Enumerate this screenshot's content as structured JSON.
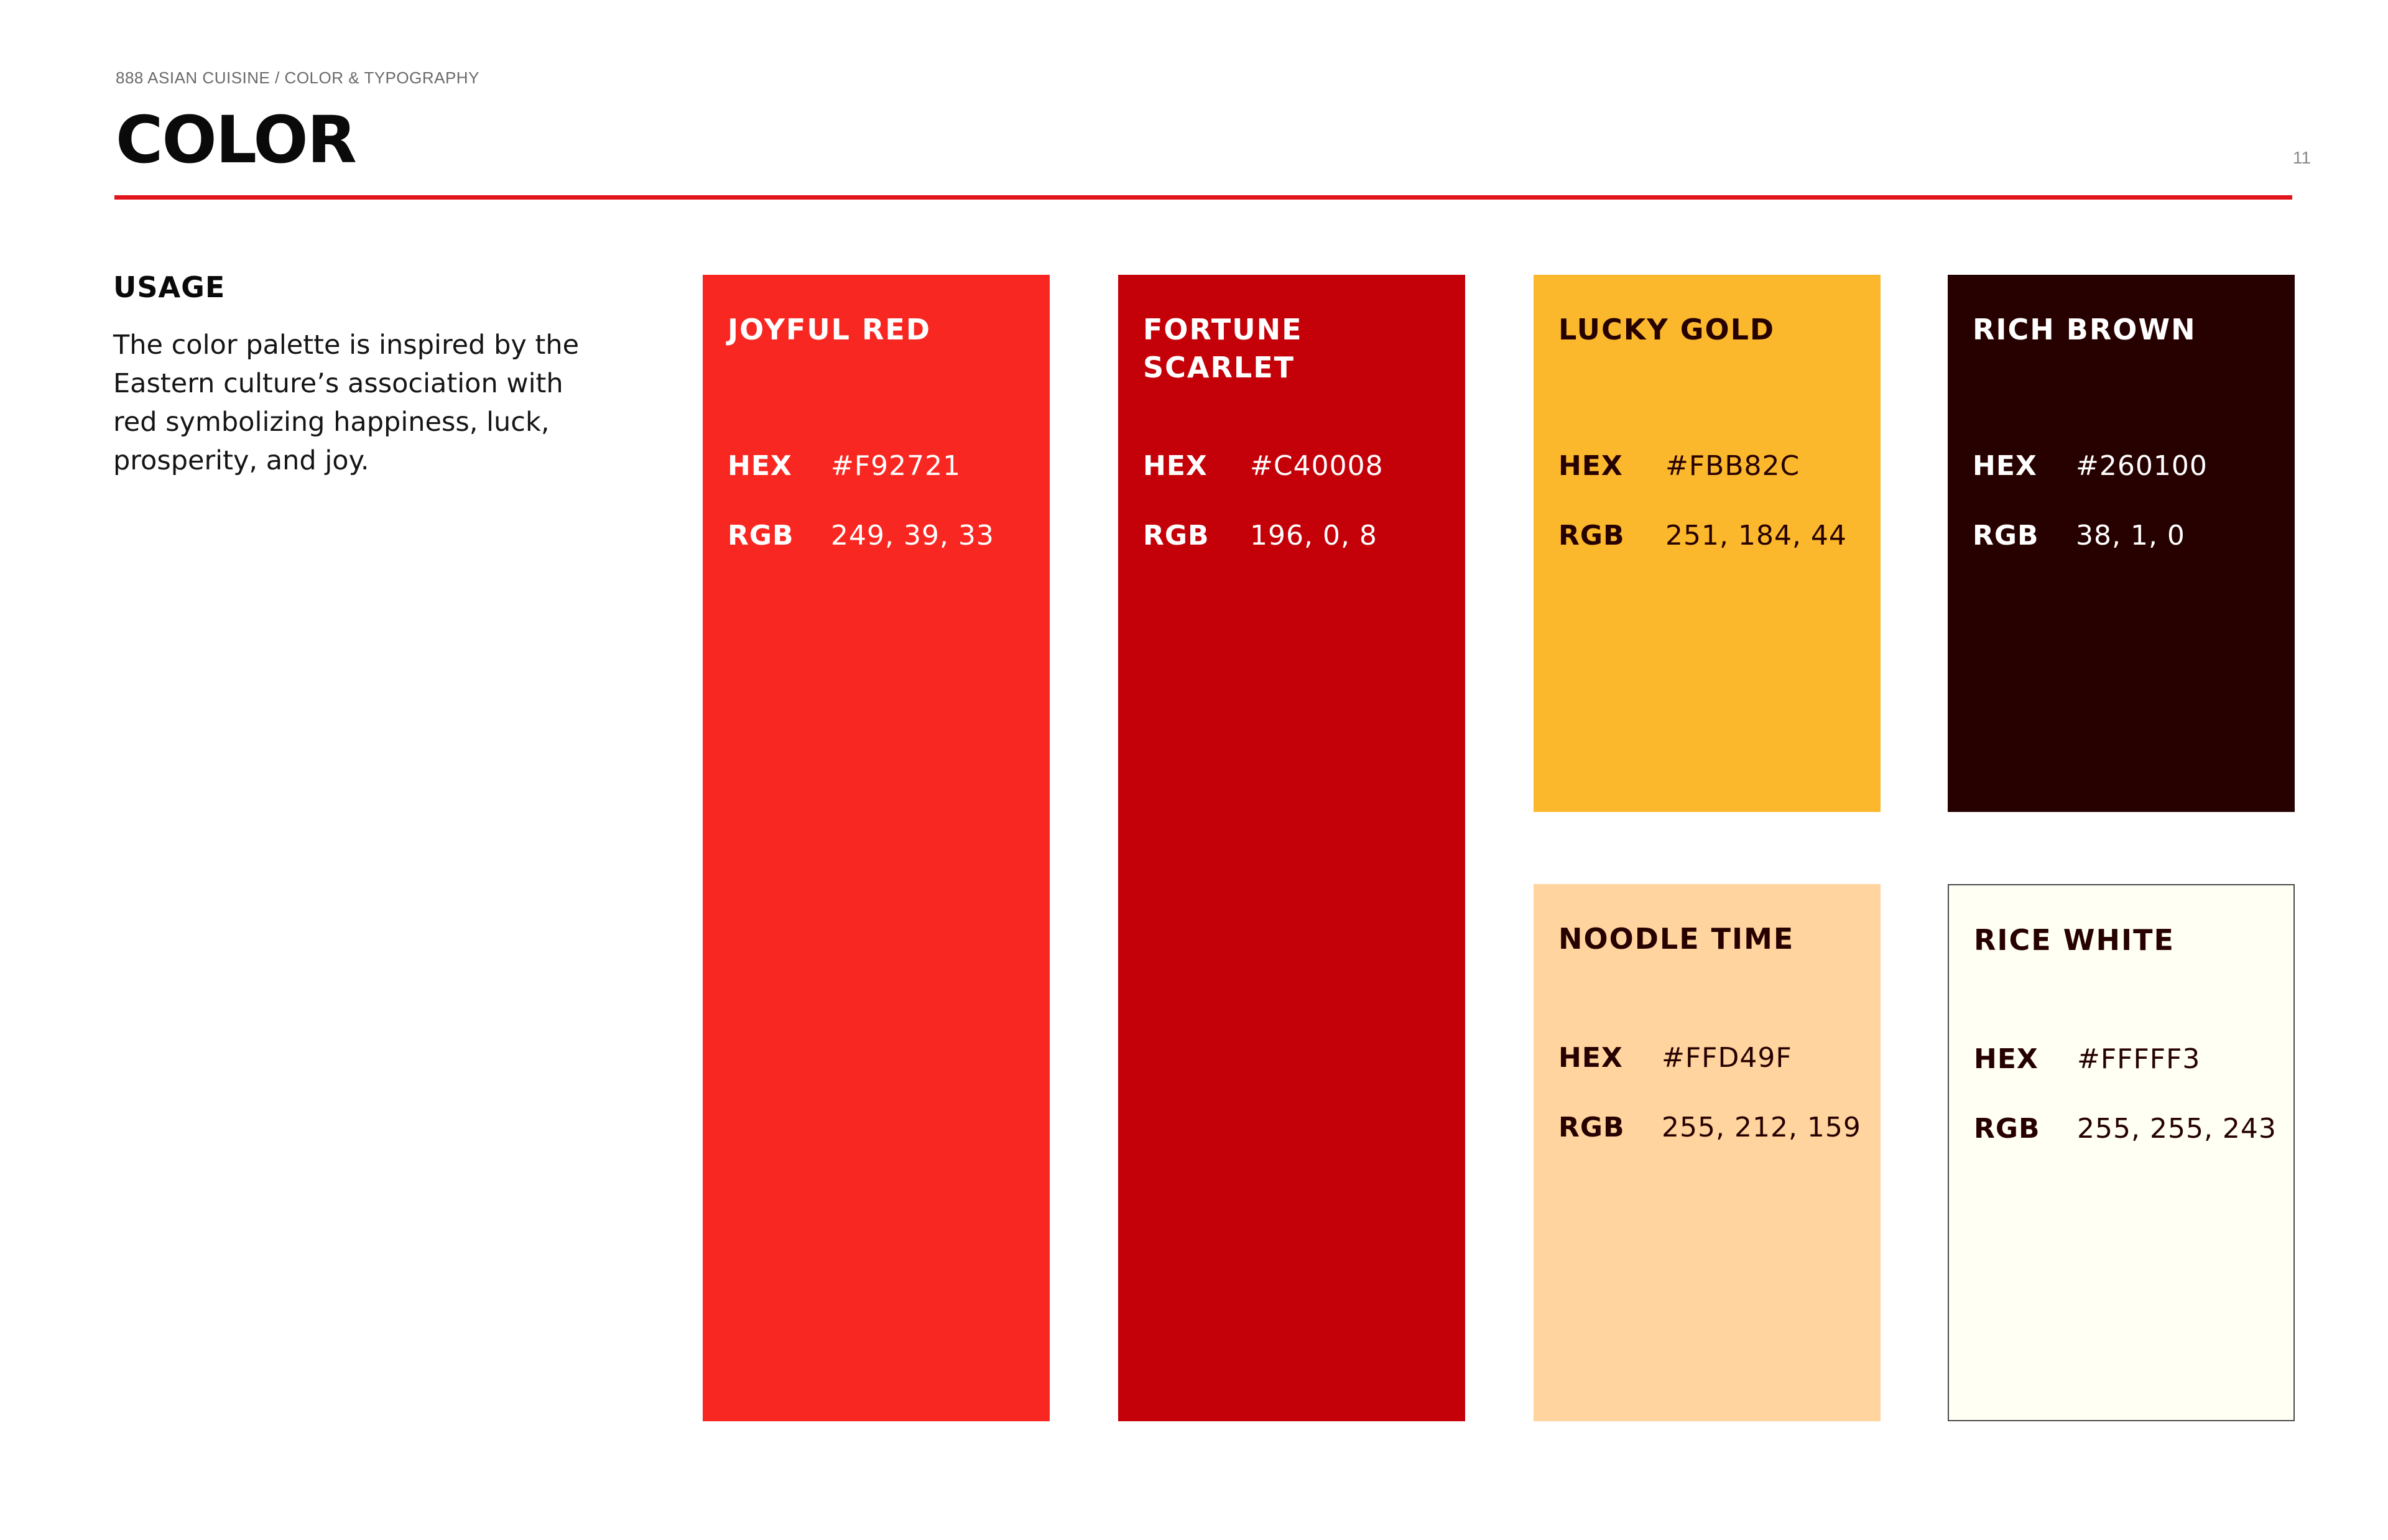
{
  "header": {
    "breadcrumb": "888 ASIAN CUISINE / COLOR & TYPOGRAPHY",
    "title": "COLOR",
    "page_number": "11",
    "rule_color": "#E2141B"
  },
  "usage": {
    "heading": "USAGE",
    "body": "The color palette is inspired by the Eastern culture’s association with red symbolizing happiness, luck, prosperity, and joy."
  },
  "swatches": [
    {
      "name": "JOYFUL RED",
      "hex_label": "HEX",
      "hex": "#F92721",
      "rgb_label": "RGB",
      "rgb": "249, 39, 33",
      "color": "#F92721",
      "text_color": "#FFFFFF"
    },
    {
      "name": "FORTUNE SCARLET",
      "hex_label": "HEX",
      "hex": "#C40008",
      "rgb_label": "RGB",
      "rgb": "196, 0, 8",
      "color": "#C40008",
      "text_color": "#FFFFFF"
    },
    {
      "name": "LUCKY GOLD",
      "hex_label": "HEX",
      "hex": "#FBB82C",
      "rgb_label": "RGB",
      "rgb": "251, 184, 44",
      "color": "#FBB82C",
      "text_color": "#260100"
    },
    {
      "name": "RICH BROWN",
      "hex_label": "HEX",
      "hex": "#260100",
      "rgb_label": "RGB",
      "rgb": "38, 1, 0",
      "color": "#260100",
      "text_color": "#FFFFFF"
    },
    {
      "name": "NOODLE TIME",
      "hex_label": "HEX",
      "hex": "#FFD49F",
      "rgb_label": "RGB",
      "rgb": "255, 212, 159",
      "color": "#FFD49F",
      "text_color": "#260100"
    },
    {
      "name": "RICE WHITE",
      "hex_label": "HEX",
      "hex": "#FFFFF3",
      "rgb_label": "RGB",
      "rgb": "255, 255, 243",
      "color": "#FFFFF3",
      "text_color": "#260100"
    }
  ]
}
